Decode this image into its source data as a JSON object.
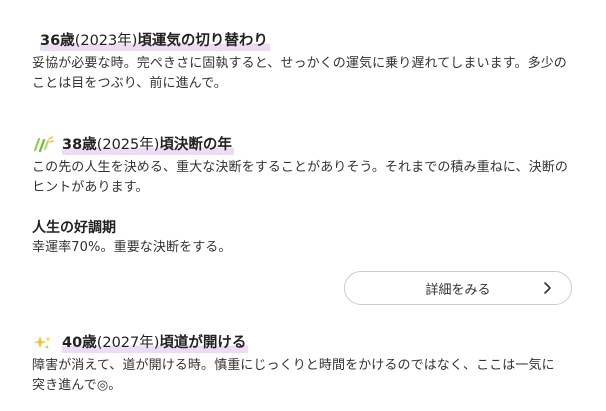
{
  "sections": [
    {
      "age": "36歳",
      "year": "(2023年)",
      "title": "頃運気の切り替わり",
      "text": "妥協が必要な時。完ぺきさに固執すると、せっかくの運気に乗り遅れてしまいます。多少のことは目をつぶり、前に進んで。",
      "icon": ""
    },
    {
      "age": "38歳",
      "year": "(2025年)",
      "title": "頃決断の年",
      "text": "この先の人生を決める、重大な決断をすることがありそう。それまでの積み重ねに、決断のヒントがあります。",
      "icon": "sparkle-lines-icon"
    },
    {
      "age": "40歳",
      "year": "(2027年)",
      "title": "頃道が開ける",
      "text": "障害が消えて、道が開ける時。慎重にじっくりと時間をかけるのではなく、ここは一気に突き進んで◎。",
      "icon": "sparkle-star-icon"
    }
  ],
  "peak": {
    "title": "人生の好調期",
    "text": "幸運率70%。重要な決断をする。"
  },
  "button": {
    "label": "詳細をみる",
    "icon": "chevron-right-icon"
  },
  "colors": {
    "highlight": "#ecdcf4",
    "icon_green": "#8fd14f",
    "icon_yellow": "#f2c230"
  }
}
